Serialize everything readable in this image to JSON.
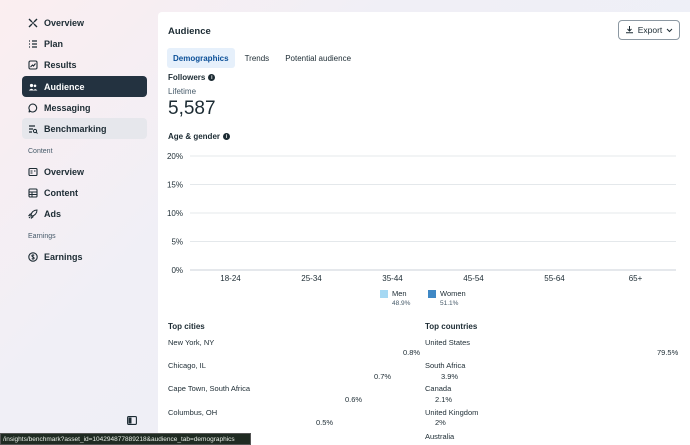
{
  "sidebar": {
    "items": [
      {
        "label": "Overview",
        "icon": "compass-icon"
      },
      {
        "label": "Plan",
        "icon": "list-icon"
      },
      {
        "label": "Results",
        "icon": "trend-icon"
      },
      {
        "label": "Audience",
        "icon": "people-icon"
      },
      {
        "label": "Messaging",
        "icon": "chat-icon"
      },
      {
        "label": "Benchmarking",
        "icon": "benchmark-icon"
      }
    ],
    "content_section": "Content",
    "content_items": [
      {
        "label": "Overview",
        "icon": "panel-icon"
      },
      {
        "label": "Content",
        "icon": "grid-icon"
      },
      {
        "label": "Ads",
        "icon": "rocket-icon"
      }
    ],
    "earnings_section": "Earnings",
    "earnings_items": [
      {
        "label": "Earnings",
        "icon": "dollar-icon"
      }
    ]
  },
  "main": {
    "title": "Audience",
    "export_label": "Export",
    "tabs": [
      "Demographics",
      "Trends",
      "Potential audience"
    ],
    "followers": {
      "label": "Followers",
      "sub": "Lifetime",
      "value": "5,587"
    },
    "age_gender_label": "Age & gender",
    "top_cities": {
      "title": "Top cities",
      "rows": [
        {
          "name": "New York, NY",
          "value": "0.8%"
        },
        {
          "name": "Chicago, IL",
          "value": "0.7%"
        },
        {
          "name": "Cape Town, South Africa",
          "value": "0.6%"
        },
        {
          "name": "Columbus, OH",
          "value": "0.5%"
        }
      ]
    },
    "top_countries": {
      "title": "Top countries",
      "rows": [
        {
          "name": "United States",
          "value": "79.5%"
        },
        {
          "name": "South Africa",
          "value": "3.9%"
        },
        {
          "name": "Canada",
          "value": "2.1%"
        },
        {
          "name": "United Kingdom",
          "value": "2%"
        },
        {
          "name": "Australia",
          "value": ""
        }
      ]
    }
  },
  "chart_data": {
    "type": "bar",
    "categories": [
      "18-24",
      "25-34",
      "35-44",
      "45-54",
      "55-64",
      "65+"
    ],
    "yticks": [
      "20%",
      "15%",
      "10%",
      "5%",
      "0%"
    ],
    "ylim": [
      0,
      20
    ],
    "series": [
      {
        "name": "Men",
        "pct": "48.9%",
        "color": "#a5d8f3",
        "values": [
          0,
          0,
          0,
          0,
          0,
          0
        ]
      },
      {
        "name": "Women",
        "pct": "51.1%",
        "color": "#3f88c5",
        "values": [
          0,
          0,
          0,
          0,
          0,
          0
        ]
      }
    ],
    "grid": true,
    "legend": "bottom"
  },
  "status_bar": {
    "url": "/insights/benchmark?asset_id=104294877889218&audience_tab=demographics"
  }
}
